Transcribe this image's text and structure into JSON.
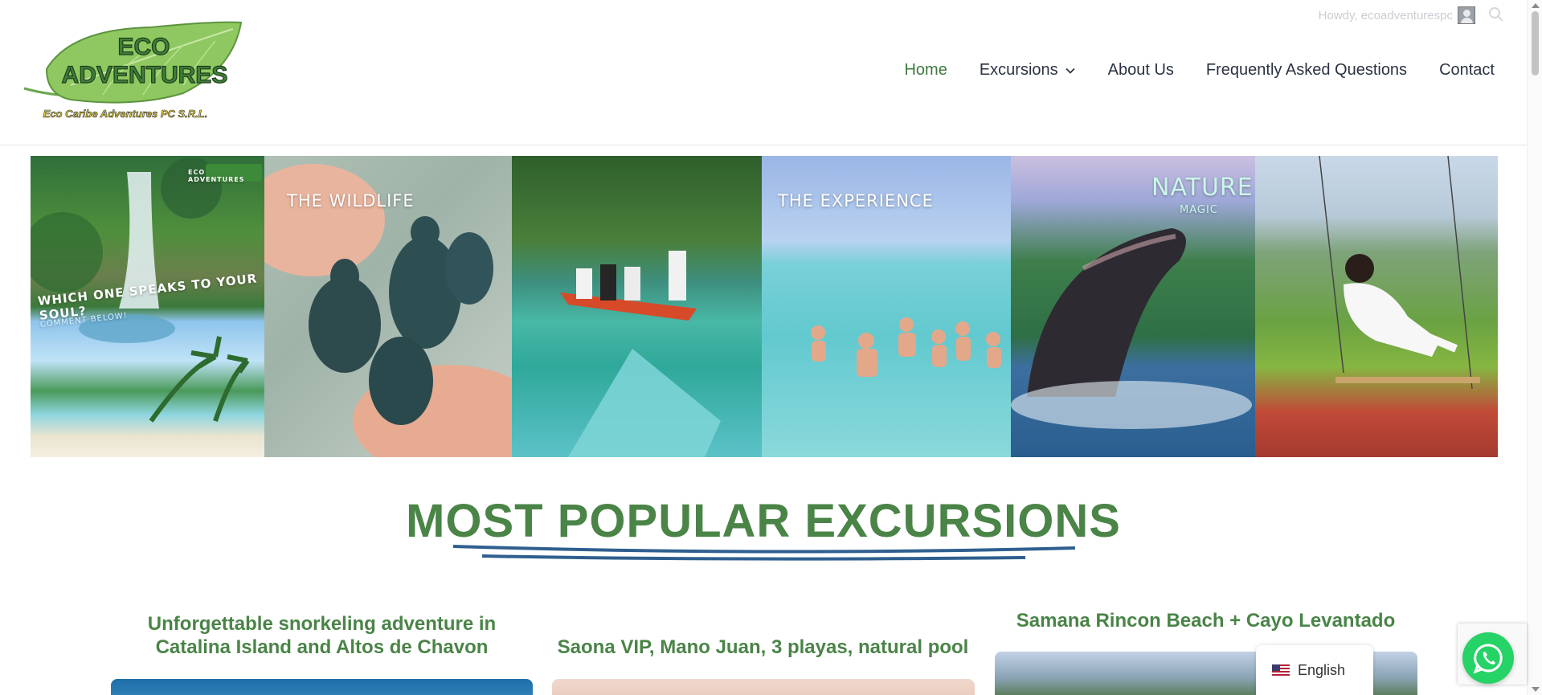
{
  "header": {
    "logo_top": "ECO",
    "logo_bottom": "ADVENTURES",
    "logo_tagline": "Eco Caribe Adventures PC S.R.L.",
    "howdy": "Howdy, ecoadventurespc",
    "nav": [
      {
        "label": "Home",
        "active": true
      },
      {
        "label": "Excursions",
        "has_dropdown": true
      },
      {
        "label": "About Us"
      },
      {
        "label": "Frequently Asked Questions"
      },
      {
        "label": "Contact"
      }
    ],
    "accent": "#3e7a3f"
  },
  "banner": {
    "captions": {
      "p1": "WHICH ONE SPEAKS TO YOUR SOUL?",
      "p1_sub": "COMMENT BELOW!",
      "p1_badge": "ECO ADVENTURES",
      "p2": "THE WILDLIFE",
      "p4": "THE EXPERIENCE",
      "p5": "NATURE",
      "p5_sub": "MAGIC"
    }
  },
  "main": {
    "section_title": "MOST POPULAR EXCURSIONS",
    "cards": [
      {
        "title": "Unforgettable snorkeling adventure in Catalina Island and Altos de Chavon"
      },
      {
        "title": "Saona VIP, Mano Juan, 3 playas, natural pool"
      },
      {
        "title": "Samana Rincon Beach + Cayo Levantado"
      }
    ]
  },
  "widgets": {
    "language": "English"
  }
}
